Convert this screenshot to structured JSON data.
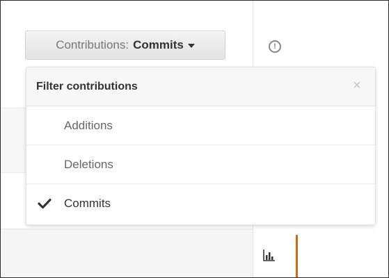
{
  "contributions_button": {
    "label": "Contributions:",
    "value": "Commits",
    "caret_icon": "caret-down-icon"
  },
  "alert_icon": {
    "icon": "alert-circle-icon",
    "glyph": "!"
  },
  "filter_menu": {
    "title": "Filter contributions",
    "close_icon": "close-icon",
    "close_glyph": "×",
    "items": [
      {
        "label": "Additions",
        "selected": false
      },
      {
        "label": "Deletions",
        "selected": false
      },
      {
        "label": "Commits",
        "selected": true
      }
    ],
    "check_icon": "checkmark-icon"
  },
  "graph_tab": {
    "icon": "bar-chart-icon",
    "active_color": "#d26911"
  }
}
